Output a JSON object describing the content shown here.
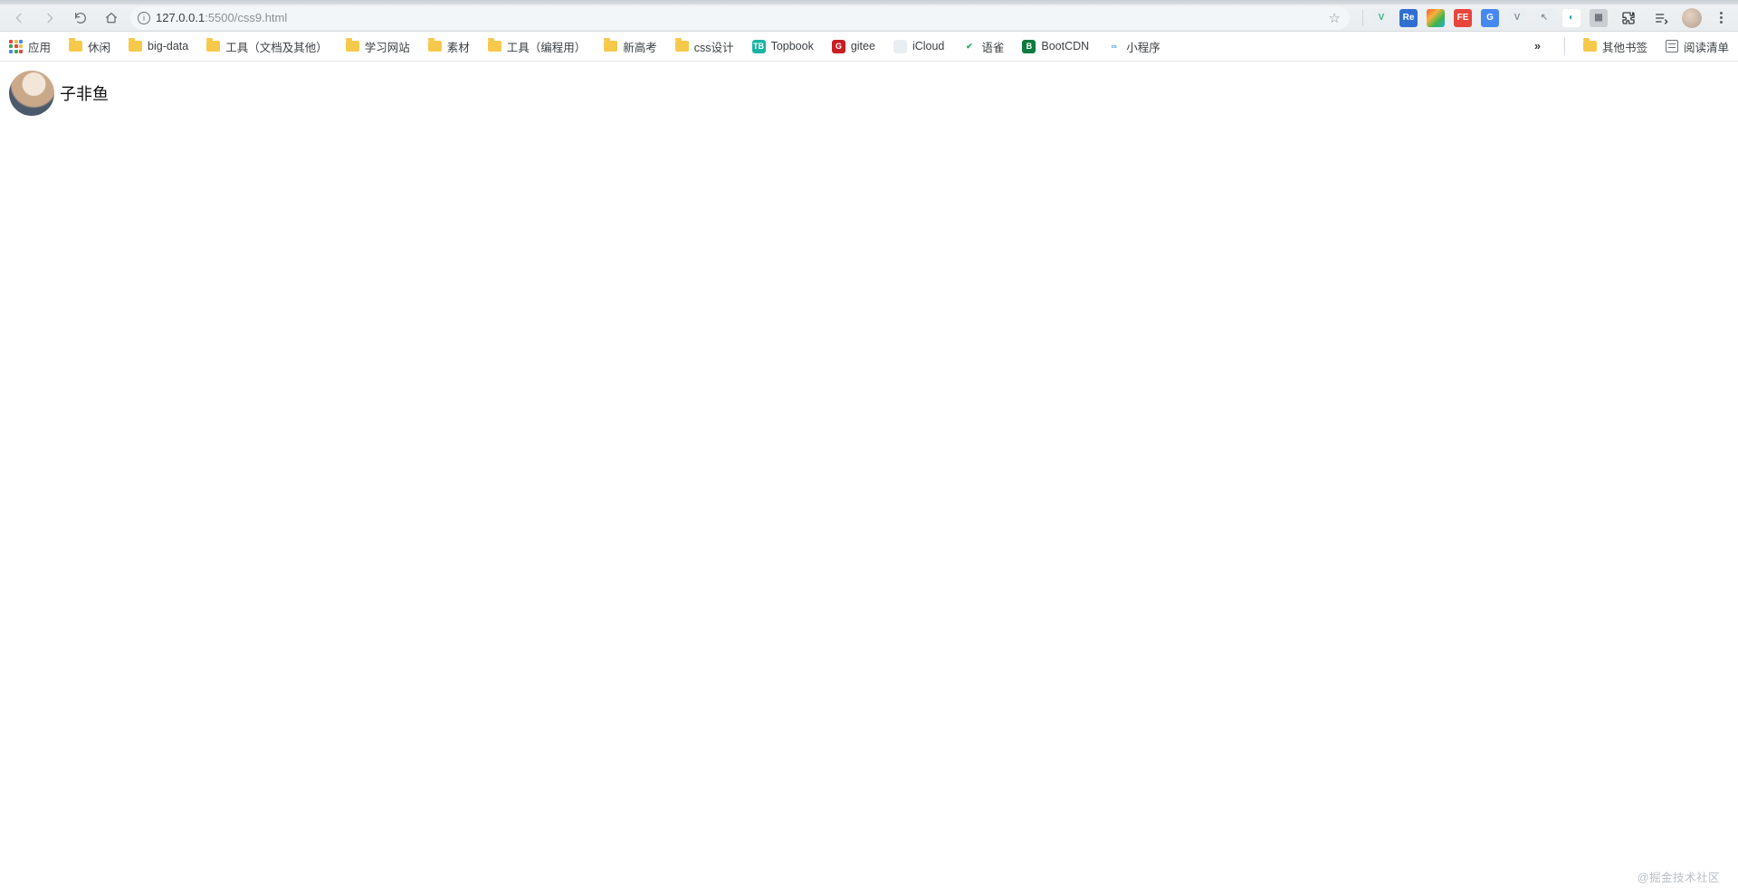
{
  "address_bar": {
    "url_host": "127.0.0.1",
    "url_port_path": ":5500/css9.html"
  },
  "extensions": [
    {
      "name": "vue-devtools",
      "bg": "#e9eef3",
      "fg": "#3fb37f",
      "glyph": "V"
    },
    {
      "name": "react-devtools",
      "bg": "#2f6fd0",
      "fg": "#ffffff",
      "glyph": "Re"
    },
    {
      "name": "color-picker",
      "bg": "linear-gradient(135deg,#f15a24,#fbb03b,#39b54a,#29abe2)",
      "fg": "#ffffff",
      "glyph": ""
    },
    {
      "name": "fe-helper",
      "bg": "#e8453c",
      "fg": "#ffffff",
      "glyph": "FE"
    },
    {
      "name": "google-translate",
      "bg": "#4688f1",
      "fg": "#ffffff",
      "glyph": "G"
    },
    {
      "name": "vimium",
      "bg": "#e9eef3",
      "fg": "#8d9196",
      "glyph": "V"
    },
    {
      "name": "cursor-tool",
      "bg": "#e9eef3",
      "fg": "#8d9196",
      "glyph": "↖"
    },
    {
      "name": "tampermonkey",
      "bg": "#ffffff",
      "fg": "#1aa6b7",
      "glyph": "◐"
    },
    {
      "name": "unknown-gray",
      "bg": "#c9ced3",
      "fg": "#6d7175",
      "glyph": "▦"
    }
  ],
  "bookmarks": {
    "apps_label": "应用",
    "items": [
      {
        "type": "folder",
        "label": "休闲"
      },
      {
        "type": "folder",
        "label": "big-data"
      },
      {
        "type": "folder",
        "label": "工具（文档及其他）"
      },
      {
        "type": "folder",
        "label": "学习网站"
      },
      {
        "type": "folder",
        "label": "素材"
      },
      {
        "type": "folder",
        "label": "工具（编程用）"
      },
      {
        "type": "folder",
        "label": "新高考"
      },
      {
        "type": "folder",
        "label": "css设计"
      },
      {
        "type": "site",
        "label": "Topbook",
        "bg": "#18b5a4",
        "fg": "#ffffff",
        "glyph": "TB"
      },
      {
        "type": "site",
        "label": "gitee",
        "bg": "#c71d23",
        "fg": "#ffffff",
        "glyph": "G"
      },
      {
        "type": "site",
        "label": "iCloud",
        "bg": "#e9eef3",
        "fg": "#8d9196",
        "glyph": ""
      },
      {
        "type": "site",
        "label": "语雀",
        "bg": "#ffffff",
        "fg": "#2aa766",
        "glyph": "✔"
      },
      {
        "type": "site",
        "label": "BootCDN",
        "bg": "#0d7a3e",
        "fg": "#ffffff",
        "glyph": "B"
      },
      {
        "type": "site",
        "label": "小程序",
        "bg": "#ffffff",
        "fg": "#5aa7e8",
        "glyph": "∞"
      }
    ],
    "other_label": "其他书签",
    "reading_list_label": "阅读清单"
  },
  "page": {
    "profile_name": "子非鱼"
  },
  "watermark": "@掘金技术社区"
}
